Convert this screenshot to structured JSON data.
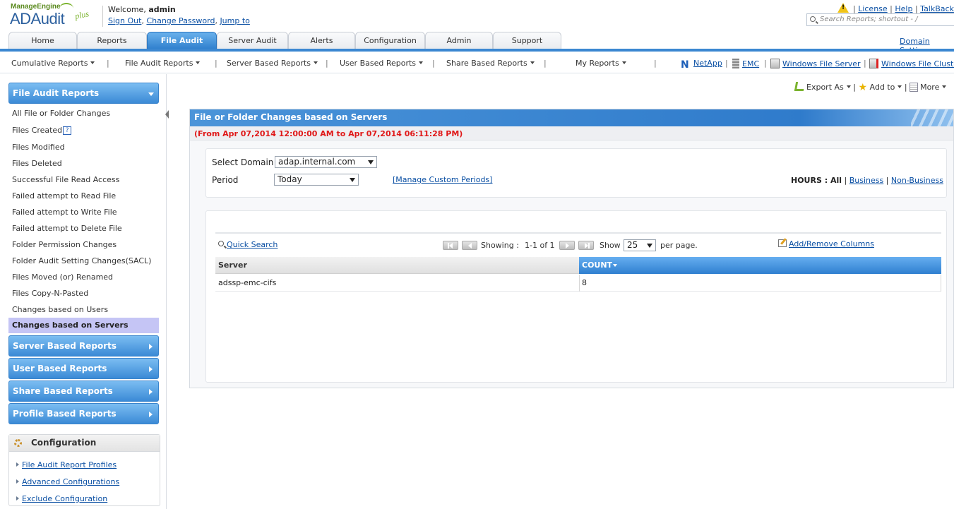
{
  "header": {
    "logo_company": "ManageEngine",
    "logo_product": "ADAudit",
    "logo_suffix": "plus",
    "welcome_prefix": "Welcome,",
    "username": "admin",
    "sign_out": "Sign Out",
    "change_password": "Change Password",
    "jump_to": "Jump to",
    "license": "License",
    "help": "Help",
    "talkback": "TalkBack",
    "search_placeholder": "Search Reports; shortout - /",
    "domain_settings": "Domain Settings"
  },
  "tabs": [
    {
      "label": "Home"
    },
    {
      "label": "Reports"
    },
    {
      "label": "File Audit",
      "active": true
    },
    {
      "label": "Server Audit"
    },
    {
      "label": "Alerts"
    },
    {
      "label": "Configuration"
    },
    {
      "label": "Admin"
    },
    {
      "label": "Support"
    }
  ],
  "subnav": {
    "items": [
      "Cumulative Reports",
      "File Audit Reports",
      "Server Based Reports",
      "User Based Reports",
      "Share Based Reports",
      "My Reports"
    ],
    "vendors": [
      "NetApp",
      "EMC",
      "Windows File Server",
      "Windows File Cluster"
    ]
  },
  "sidebar": {
    "section_title": "File Audit Reports",
    "items": [
      "All File or Folder Changes",
      "Files Created",
      "Files Modified",
      "Files Deleted",
      "Successful File Read Access",
      "Failed attempt to Read File",
      "Failed attempt to Write File",
      "Failed attempt to Delete File",
      "Folder Permission Changes",
      "Folder Audit Setting Changes(SACL)",
      "Files Moved (or) Renamed",
      "Files Copy-N-Pasted",
      "Changes based on Users",
      "Changes based on Servers"
    ],
    "help_mark": "?",
    "groups": [
      "Server Based Reports",
      "User Based Reports",
      "Share Based Reports",
      "Profile Based Reports"
    ],
    "config_title": "Configuration",
    "config_links": [
      "File Audit Report Profiles",
      "Advanced Configurations",
      "Exclude Configuration"
    ]
  },
  "toolbar": {
    "export": "Export As",
    "add_to": "Add to",
    "more": "More"
  },
  "report": {
    "title": "File or Folder Changes based on Servers",
    "date_range": "(From Apr 07,2014 12:00:00 AM to Apr 07,2014 06:11:28 PM)",
    "domain_label": "Select Domain",
    "domain_value": "adap.internal.com",
    "period_label": "Period",
    "period_value": "Today",
    "manage_periods": "[Manage Custom Periods]",
    "hours_label": "HOURS : All",
    "hours_business": "Business",
    "hours_nonbusiness": "Non-Business"
  },
  "grid": {
    "quick_search": "Quick Search",
    "showing_label": "Showing :",
    "range": "1-1 of 1",
    "show_label": "Show",
    "page_size": "25",
    "per_page": "per page.",
    "add_remove_columns": "Add/Remove Columns",
    "columns": [
      "Server",
      "COUNT"
    ],
    "rows": [
      {
        "server": "adssp-emc-cifs",
        "count": "8"
      }
    ]
  }
}
